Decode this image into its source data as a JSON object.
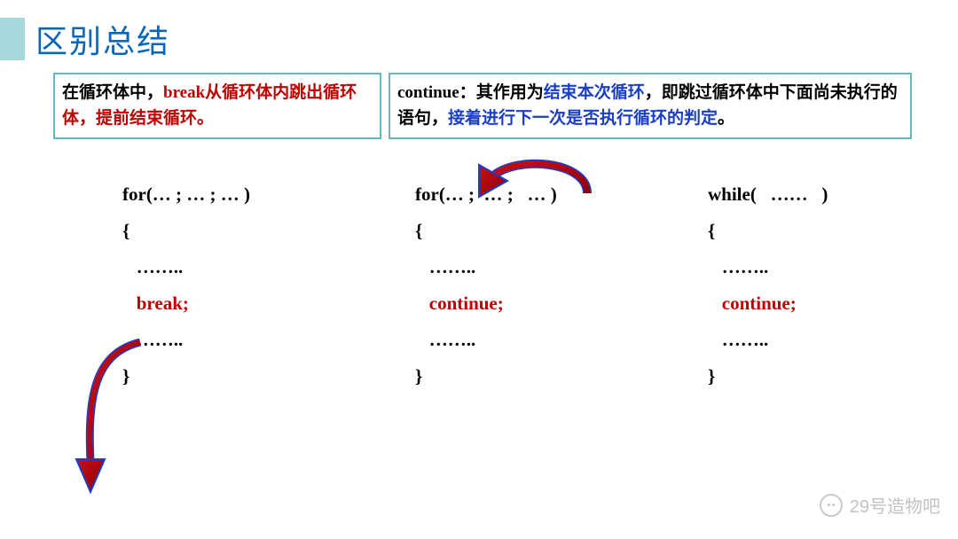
{
  "title": "区别总结",
  "box_left": {
    "p1a": "在循环体中，",
    "p1b": "break从循环体内跳出循环体，提前结束循环。"
  },
  "box_right": {
    "p1a": "continue：",
    "p1b": "其作用为",
    "p1c": "结束本次循环",
    "p1d": "，即跳过循环体中下面尚未执行的语句，",
    "p1e": "接着进行下一次是否执行循环的判定",
    "p1f": "。"
  },
  "code": {
    "col1": {
      "l1": "for(… ; … ; … )",
      "l2": "{",
      "l3": "   ……..",
      "l4": "   break;",
      "l5": "   ……..",
      "l6": "}"
    },
    "col2": {
      "l1": "for(… ;  … ;   … )",
      "l2": "{",
      "l3": "   ……..",
      "l4": "   continue;",
      "l5": "   ……..",
      "l6": "}"
    },
    "col3": {
      "l1": "while(   ……   )",
      "l2": "{",
      "l3": "   ……..",
      "l4": "   continue;",
      "l5": "   ……..",
      "l6": "}"
    }
  },
  "watermark": "29号造物吧"
}
